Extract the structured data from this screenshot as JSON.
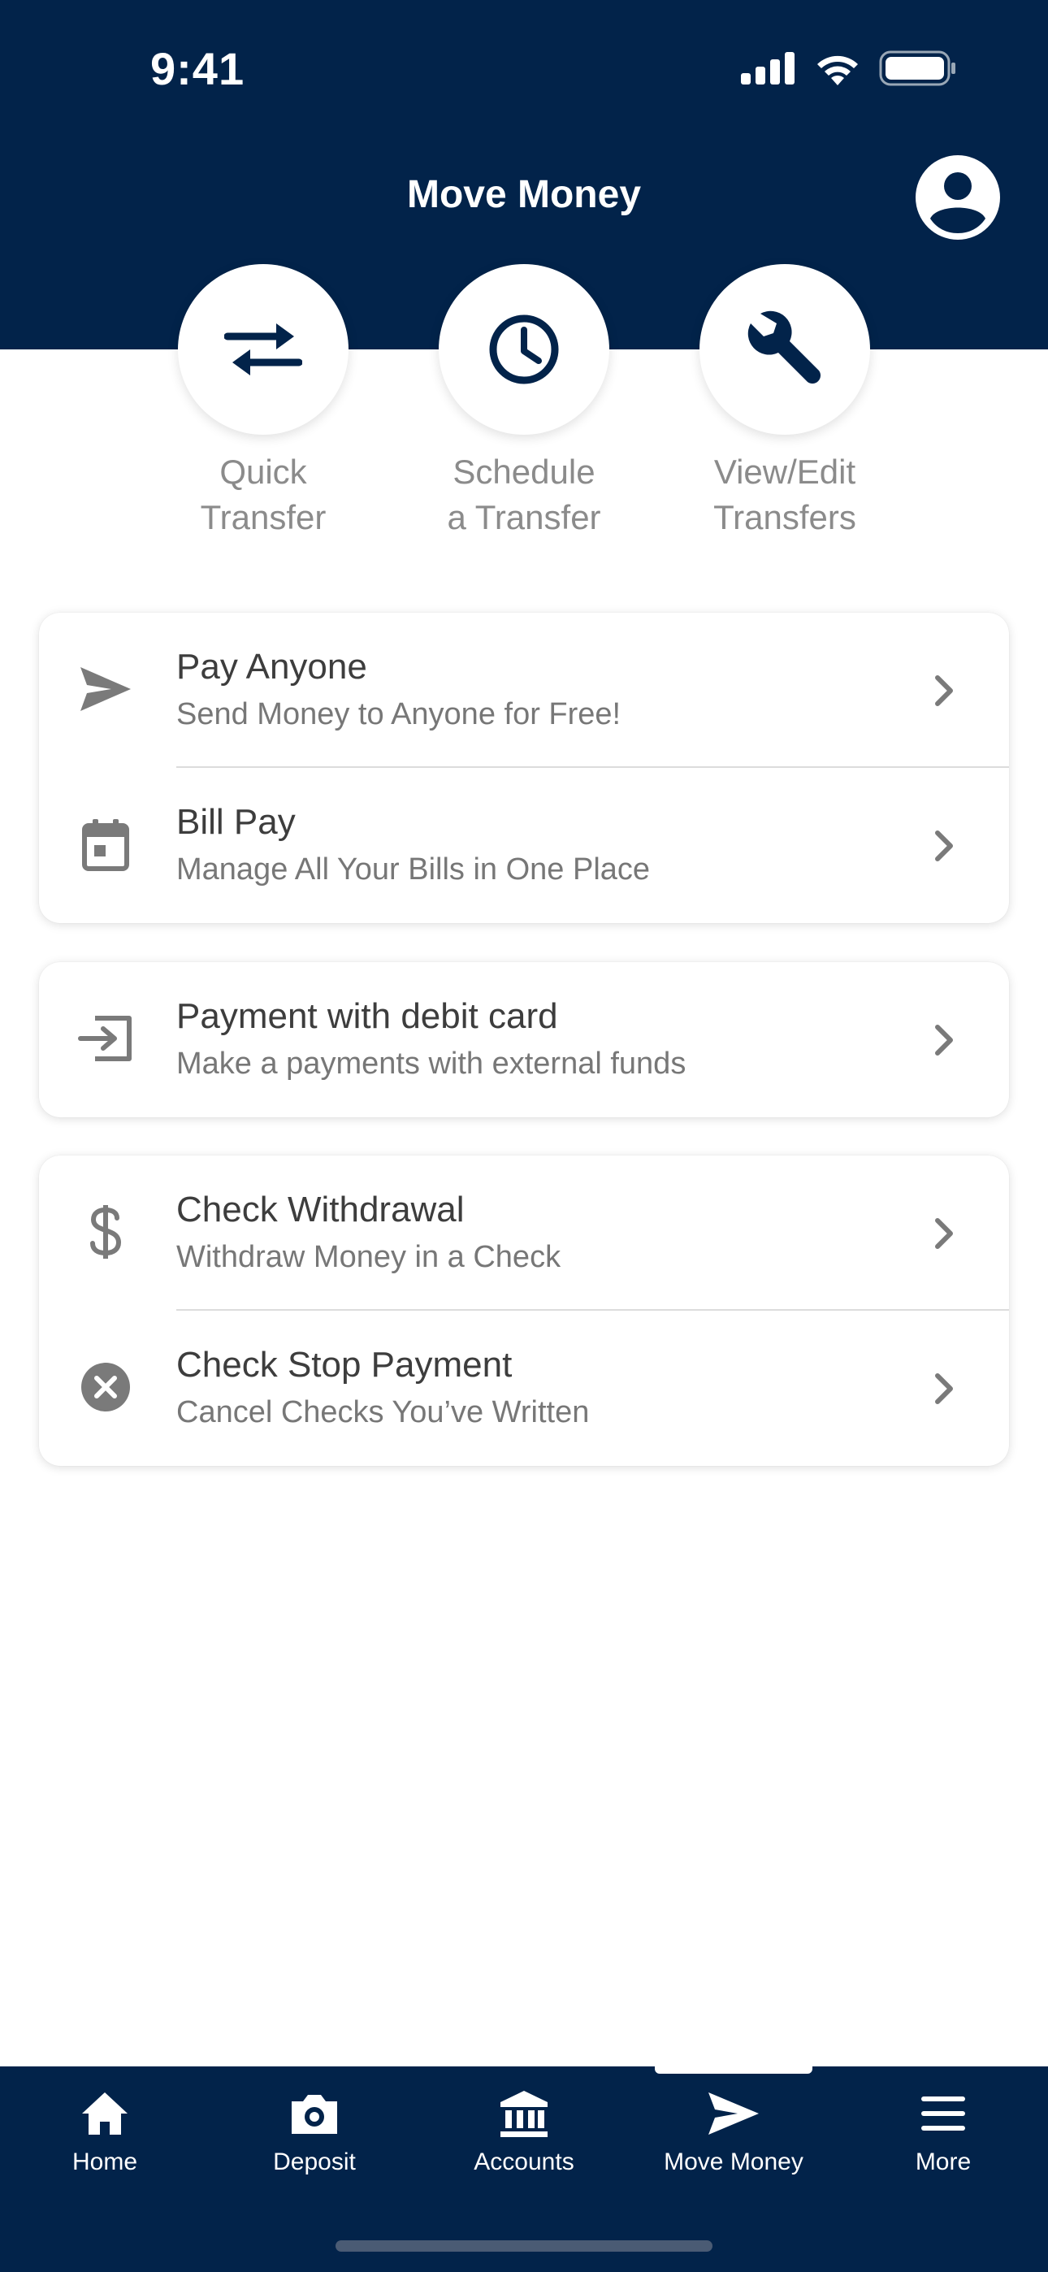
{
  "status_bar": {
    "time": "9:41"
  },
  "header": {
    "title": "Move Money"
  },
  "quick_actions": [
    {
      "label": "Quick\nTransfer",
      "icon": "transfer-arrows-icon"
    },
    {
      "label": "Schedule\na Transfer",
      "icon": "clock-icon"
    },
    {
      "label": "View/Edit\nTransfers",
      "icon": "wrench-icon"
    }
  ],
  "cards": [
    {
      "rows": [
        {
          "title": "Pay Anyone",
          "subtitle": "Send Money to Anyone for Free!",
          "icon": "send-icon"
        },
        {
          "title": "Bill Pay",
          "subtitle": "Manage All Your Bills in One Place",
          "icon": "calendar-icon"
        }
      ]
    },
    {
      "rows": [
        {
          "title": "Payment with debit card",
          "subtitle": "Make a payments with external funds",
          "icon": "card-transfer-icon"
        }
      ]
    },
    {
      "rows": [
        {
          "title": "Check Withdrawal",
          "subtitle": "Withdraw Money in a Check",
          "icon": "dollar-icon"
        },
        {
          "title": "Check Stop Payment",
          "subtitle": "Cancel Checks You’ve Written",
          "icon": "cancel-circle-icon"
        }
      ]
    }
  ],
  "tabbar": {
    "tabs": [
      {
        "label": "Home",
        "icon": "home-icon"
      },
      {
        "label": "Deposit",
        "icon": "camera-icon"
      },
      {
        "label": "Accounts",
        "icon": "bank-icon"
      },
      {
        "label": "Move Money",
        "icon": "send-icon",
        "active": true
      },
      {
        "label": "More",
        "icon": "menu-icon"
      }
    ]
  },
  "colors": {
    "header_bg": "#02234a",
    "icon_gray": "#7a7a7a",
    "label_gray": "#8b8b8b"
  }
}
